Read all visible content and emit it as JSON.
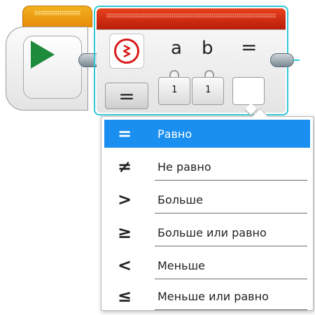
{
  "compare_block": {
    "param_a_label": "a",
    "param_b_label": "b",
    "result_label": "=",
    "param_a_value": "1",
    "param_b_value": "1",
    "mode_symbol": "="
  },
  "dropdown": {
    "selected_index": 0,
    "items": [
      {
        "symbol": "=",
        "label": "Равно",
        "selected": true
      },
      {
        "symbol": "≠",
        "label": "Не равно",
        "selected": false
      },
      {
        "symbol": ">",
        "label": "Больше",
        "selected": false
      },
      {
        "symbol": "≥",
        "label": "Больше или равно",
        "selected": false
      },
      {
        "symbol": "<",
        "label": "Меньше",
        "selected": false
      },
      {
        "symbol": "≤",
        "label": "Меньше или равно",
        "selected": false
      }
    ]
  },
  "icons": {
    "start": "play-triangle-icon",
    "compare": "compare-wave-icon"
  },
  "colors": {
    "start_header": "#e78a06",
    "play": "#1e8a3c",
    "compare_header": "#c8280c",
    "selection_outline": "#2fc7d7",
    "selected_item": "#1a8ff0"
  }
}
